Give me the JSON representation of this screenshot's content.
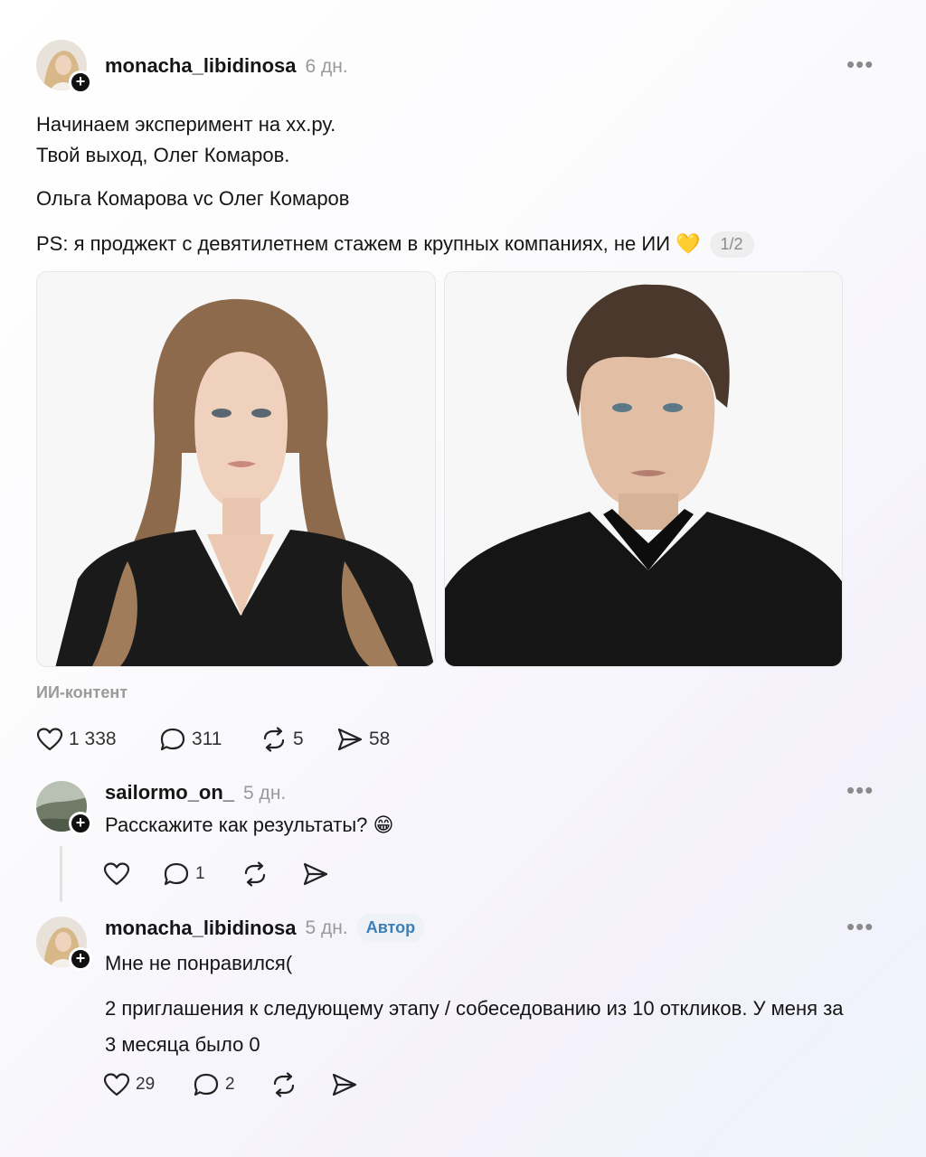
{
  "post": {
    "username": "monacha_libidinosa",
    "time": "6 дн.",
    "lines": [
      "Начинаем эксперимент на хх.ру.",
      "Твой выход, Олег Комаров.",
      "Ольга Комарова vс Олег Комаров",
      "PS: я проджект с девятилетнем стажем в крупных компаниях, не ИИ 💛"
    ],
    "page_indicator": "1/2",
    "ai_label": "ИИ-контент",
    "likes": "1 338",
    "comments": "311",
    "reposts": "5",
    "shares": "58"
  },
  "comment1": {
    "username": "sailormo_on_",
    "time": "5 дн.",
    "text": "Расскажите как результаты? 😁",
    "comments": "1"
  },
  "comment2": {
    "username": "monacha_libidinosa",
    "time": "5 дн.",
    "badge": "Автор",
    "text1": "Мне не понравился(",
    "text2": "2 приглашения к следующему этапу / собеседованию из 10 откликов. У меня за 3 месяца было 0",
    "likes": "29",
    "comments": "2"
  },
  "icons": {
    "more": "more-horizontal-icon",
    "like": "heart-icon",
    "comment": "comment-bubble-icon",
    "repost": "repost-icon",
    "share": "send-icon",
    "follow": "plus-icon"
  }
}
